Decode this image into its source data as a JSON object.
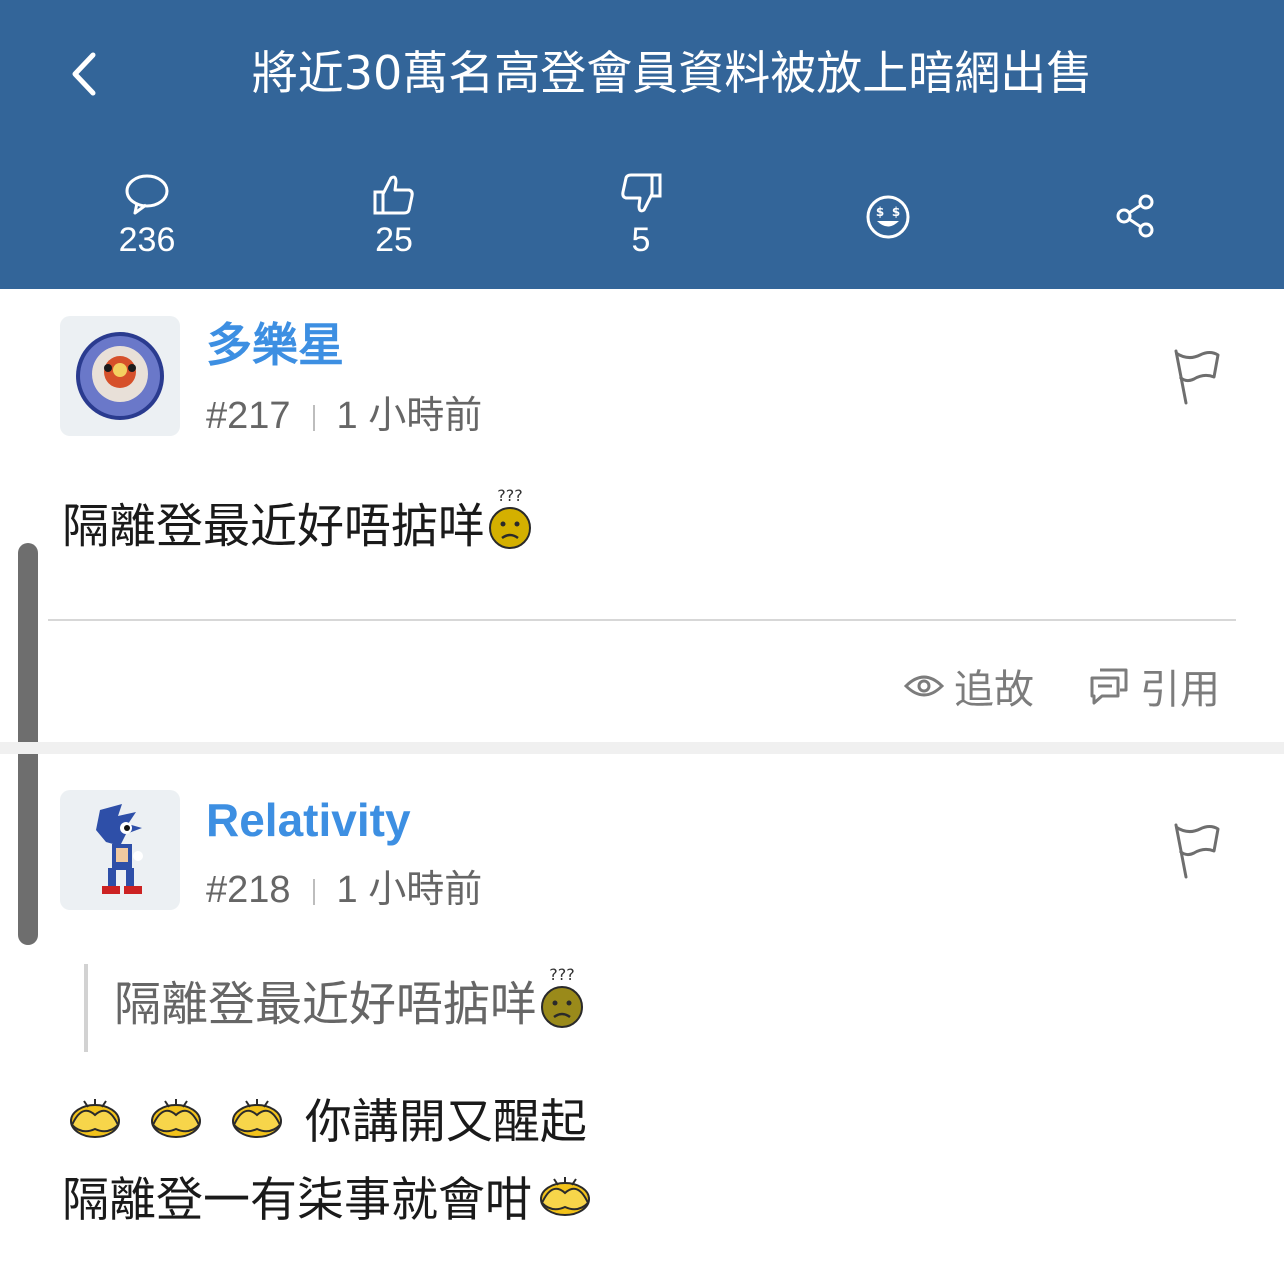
{
  "header": {
    "title": "將近30萬名高登會員資料被放上暗網出售",
    "background": "#336599",
    "stats": {
      "comments": "236",
      "likes": "25",
      "dislikes": "5"
    }
  },
  "posts": [
    {
      "username": "多樂星",
      "floor": "#217",
      "time": "1 小時前",
      "content": "隔離登最近好唔掂咩",
      "actions": {
        "follow": "追故",
        "quote": "引用"
      }
    },
    {
      "username": "Relativity",
      "floor": "#218",
      "time": "1 小時前",
      "quoted": "隔離登最近好唔掂咩",
      "line1": "你講開又醒起",
      "line2": "隔離登一有柒事就會咁"
    }
  ],
  "colors": {
    "accent": "#3d8fe2",
    "meta": "#666666"
  }
}
